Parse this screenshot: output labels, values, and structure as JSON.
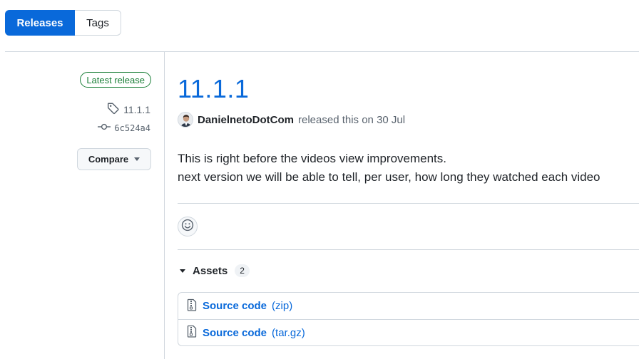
{
  "tabs": [
    {
      "label": "Releases",
      "active": true
    },
    {
      "label": "Tags",
      "active": false
    }
  ],
  "sidebar": {
    "badge": "Latest release",
    "tag": "11.1.1",
    "commit": "6c524a4",
    "compare_label": "Compare"
  },
  "release": {
    "title": "11.1.1",
    "author": "DanielnetoDotCom",
    "released_text": "released this on 30 Jul",
    "body": [
      "This is right before the videos view improvements.",
      "next version we will be able to tell, per user, how long they watched each video"
    ]
  },
  "assets": {
    "label": "Assets",
    "count": "2",
    "items": [
      {
        "name": "Source code",
        "ext": "(zip)"
      },
      {
        "name": "Source code",
        "ext": "(tar.gz)"
      }
    ]
  },
  "colors": {
    "accent": "#0969da",
    "success": "#1a7f37",
    "border": "#d0d7de"
  }
}
